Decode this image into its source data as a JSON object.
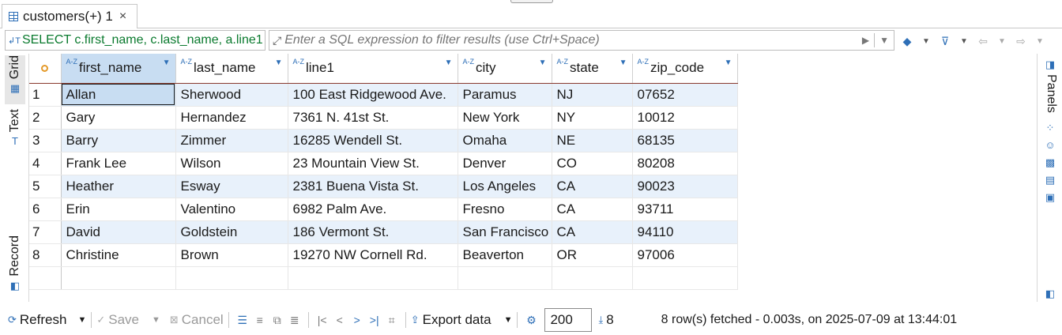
{
  "tab": {
    "title": "customers(+) 1",
    "close": "×"
  },
  "filter": {
    "sql": "SELECT c.first_name, c.last_name, a.line1",
    "placeholder": "Enter a SQL expression to filter results (use Ctrl+Space)"
  },
  "left_tabs": {
    "grid": "Grid",
    "text": "Text",
    "record": "Record"
  },
  "right_panel": {
    "label": "Panels"
  },
  "columns": [
    {
      "name": "first_name",
      "type_icon": "A-Z"
    },
    {
      "name": "last_name",
      "type_icon": "A-Z"
    },
    {
      "name": "line1",
      "type_icon": "A-Z"
    },
    {
      "name": "city",
      "type_icon": "A-Z"
    },
    {
      "name": "state",
      "type_icon": "A-Z"
    },
    {
      "name": "zip_code",
      "type_icon": "A-Z"
    }
  ],
  "rows": [
    [
      "1",
      "Allan",
      "Sherwood",
      "100 East Ridgewood Ave.",
      "Paramus",
      "NJ",
      "07652"
    ],
    [
      "2",
      "Gary",
      "Hernandez",
      "7361 N. 41st St.",
      "New York",
      "NY",
      "10012"
    ],
    [
      "3",
      "Barry",
      "Zimmer",
      "16285 Wendell St.",
      "Omaha",
      "NE",
      "68135"
    ],
    [
      "4",
      "Frank Lee",
      "Wilson",
      "23 Mountain View St.",
      "Denver",
      "CO",
      "80208"
    ],
    [
      "5",
      "Heather",
      "Esway",
      "2381 Buena Vista St.",
      "Los Angeles",
      "CA",
      "90023"
    ],
    [
      "6",
      "Erin",
      "Valentino",
      "6982 Palm Ave.",
      "Fresno",
      "CA",
      "93711"
    ],
    [
      "7",
      "David",
      "Goldstein",
      "186 Vermont St.",
      "San Francisco",
      "CA",
      "94110"
    ],
    [
      "8",
      "Christine",
      "Brown",
      "19270 NW Cornell Rd.",
      "Beaverton",
      "OR",
      "97006"
    ]
  ],
  "toolbar": {
    "refresh": "Refresh",
    "save": "Save",
    "cancel": "Cancel",
    "export": "Export data",
    "fetch_size": "200",
    "row_count": "8",
    "status": "8 row(s) fetched - 0.003s, on 2025-07-09 at 13:44:01"
  },
  "colors": {
    "accent": "#2e6fb7",
    "row_alt": "#e8f1fb",
    "selection": "#c8ddf2",
    "sql_text": "#0a7a2e"
  }
}
